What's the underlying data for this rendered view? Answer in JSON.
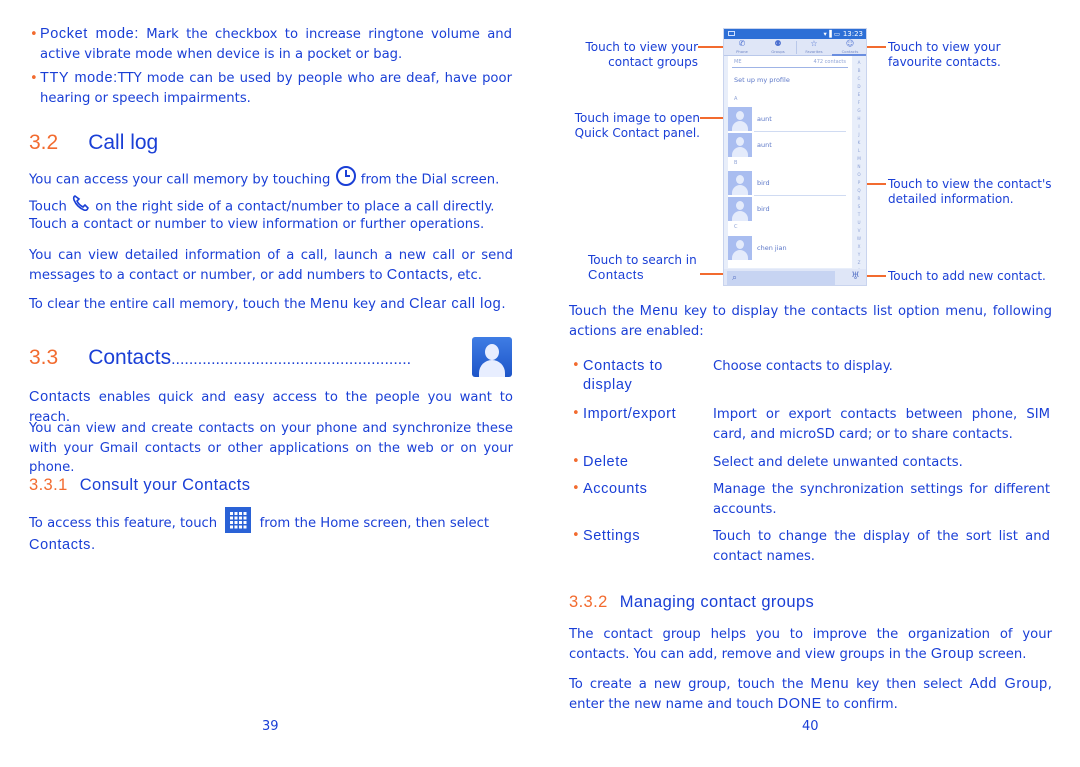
{
  "left_page": {
    "bullets": [
      {
        "term": "Pocket mode:",
        "text": " Mark the checkbox to increase ringtone volume and active vibrate mode when device is in a pocket or bag."
      },
      {
        "term": "TTY mode:",
        "text": "TTY mode can be used by people who are deaf, have poor hearing or speech impairments."
      }
    ],
    "section_call_log": {
      "number": "3.2",
      "title": "Call log",
      "p1_a": "You can access your call memory by touching",
      "p1_b": "from the Dial screen.",
      "p1_c": "Touch",
      "p1_d": "on the right side of a contact/number to place a call directly.",
      "p2": "Touch a contact or number to view information or further operations.",
      "p3_a": "You can view detailed information of a call, launch a new call or send messages to a contact or number, or add numbers to ",
      "p3_kw": "Contacts",
      "p3_b": ", etc.",
      "p4_a": "To clear the entire call memory, touch the ",
      "p4_kw1": "Menu",
      "p4_b": " key and ",
      "p4_kw2": "Clear call log",
      "p4_c": ".",
      "icons": {
        "history": "clock-icon",
        "call": "phone-handset-icon"
      }
    },
    "section_contacts": {
      "number": "3.3",
      "title": "Contacts",
      "leader": "......................................................",
      "icon": "contacts-app-icon",
      "p1_kw": "Contacts",
      "p1": " enables quick and easy access to the people you want to reach.",
      "p2": "You can view and create contacts on your phone and synchronize these with your Gmail contacts or other applications on the web or on your phone."
    },
    "section_consult": {
      "number": "3.3.1",
      "title": "Consult your Contacts",
      "p1_a": "To access this feature, touch",
      "p1_b": "from the Home screen, then select",
      "p1_kw": "Contacts",
      "p1_c": ".",
      "icon": "app-drawer-icon"
    },
    "page_number": "39"
  },
  "right_page": {
    "callouts": {
      "groups": "Touch to view your contact groups",
      "groups_l1": "Touch to view your",
      "groups_l2": "contact groups",
      "favourites_l1": "Touch to view your",
      "favourites_l2": "favourite contacts.",
      "quick_l1": "Touch image to open",
      "quick_l2": "Quick Contact panel.",
      "detail_l1": "Touch to view the contact's",
      "detail_l2": "detailed information.",
      "search_l1": "Touch to search in",
      "search_l2": "Contacts",
      "add": "Touch to add new contact."
    },
    "phone": {
      "status_time": "13:23",
      "status_signal": "▾▐ ▭",
      "tabs": [
        {
          "label": "Phone",
          "icon": "phone-icon",
          "glyph": "✆"
        },
        {
          "label": "Groups",
          "icon": "groups-icon",
          "glyph": "⚉"
        },
        {
          "label": "Favorites",
          "icon": "star-icon",
          "glyph": "☆"
        },
        {
          "label": "Contacts",
          "icon": "person-icon",
          "glyph": "☺"
        }
      ],
      "me_label": "ME",
      "contact_count": "472 contacts",
      "setup_profile": "Set up my profile",
      "sections": [
        "A",
        "B",
        "C"
      ],
      "contacts": [
        "aunt",
        "aunt",
        "bird",
        "bird",
        "chen jian"
      ],
      "alphabet": [
        "A",
        "B",
        "C",
        "D",
        "E",
        "F",
        "G",
        "H",
        "I",
        "J",
        "K",
        "L",
        "M",
        "N",
        "O",
        "P",
        "Q",
        "R",
        "S",
        "T",
        "U",
        "V",
        "W",
        "X",
        "Y",
        "Z",
        "#"
      ],
      "search_icon": "⌕",
      "add_contact_icon": "♅"
    },
    "intro_a": "Touch the ",
    "intro_kw": "Menu",
    "intro_b": " key to display the contacts list option menu, following actions are enabled:",
    "options": [
      {
        "label_l1": "Contacts to",
        "label_l2": "display",
        "desc": "Choose contacts to display."
      },
      {
        "label_l1": "Import/export",
        "label_l2": "",
        "desc": "Import or export contacts between phone, SIM card, and microSD card; or to share contacts."
      },
      {
        "label_l1": "Delete",
        "label_l2": "",
        "desc": "Select and delete unwanted contacts."
      },
      {
        "label_l1": "Accounts",
        "label_l2": "",
        "desc": "Manage the synchronization settings for different accounts."
      },
      {
        "label_l1": "Settings",
        "label_l2": "",
        "desc": "Touch to change the display of the sort list and contact names."
      }
    ],
    "section_groups": {
      "number": "3.3.2",
      "title": "Managing contact groups",
      "p1_a": "The contact group helps you to improve the organization of your contacts. You can add, remove and view groups in the ",
      "p1_kw": "Group",
      "p1_b": " screen.",
      "p2_a": "To create a new group, touch the ",
      "p2_kw1": "Menu",
      "p2_b": " key then select ",
      "p2_kw2": "Add Group",
      "p2_c": ", enter the new name and touch ",
      "p2_kw3": "DONE",
      "p2_d": " to confirm."
    },
    "page_number": "40"
  },
  "colors": {
    "text": "#1a3fd6",
    "accent": "#f26b2f",
    "phone_bar": "#2d6fd6"
  }
}
